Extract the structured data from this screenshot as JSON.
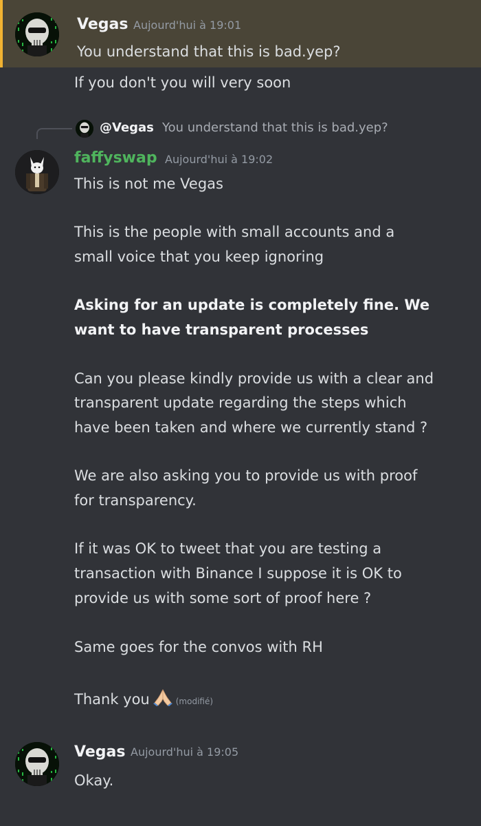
{
  "messages": [
    {
      "author": "Vegas",
      "timestamp": "Aujourd'hui à 19:01",
      "highlighted": true,
      "lines": [
        "You understand that this is bad.yep?",
        "If you don't you will very soon"
      ]
    },
    {
      "reply": {
        "mention": "@Vegas",
        "text": "You understand that this is bad.yep?"
      },
      "author": "faffyswap",
      "timestamp": "Aujourd'hui à 19:02",
      "lines": [
        "This is not me Vegas",
        "This is the people with small accounts and a",
        "small voice that you keep ignoring",
        "Asking for an update is completely fine. We",
        "want to have transparent processes",
        "Can you please kindly provide us with a clear and",
        "transparent update regarding the steps which",
        "have been taken and where we currently stand ?",
        "We are also asking you to provide us with proof",
        "for transparency.",
        "If it was OK to tweet that you are testing a",
        "transaction with Binance I suppose it is OK to",
        "provide us with some sort of proof here ?",
        "Same goes for the convos with RH",
        "Thank you"
      ],
      "edited": "(modifié)"
    },
    {
      "author": "Vegas",
      "timestamp": "Aujourd'hui à 19:05",
      "lines": [
        "Okay."
      ]
    }
  ],
  "colors": {
    "background": "#313338",
    "highlight_bg": "#4a4537",
    "highlight_bar": "#f0b232",
    "faffyswap_name": "#4fb45d",
    "timestamp": "#949ba4"
  },
  "icons": {
    "vegas_avatar": "skull-matrix-avatar",
    "faffyswap_avatar": "wolf-suit-avatar",
    "reaction_emoji": "folded-hands-emoji"
  }
}
